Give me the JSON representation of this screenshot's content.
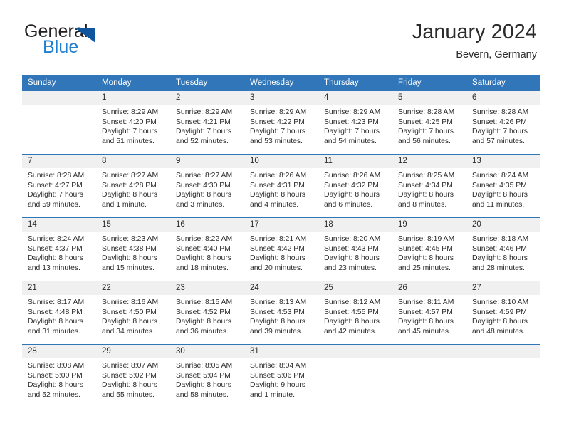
{
  "brand": {
    "name_part1": "General",
    "name_part2": "Blue",
    "triangle_icon": "triangle-icon"
  },
  "header": {
    "title": "January 2024",
    "location": "Bevern, Germany"
  },
  "colors": {
    "header_blue": "#3176b9",
    "row_divider": "#2f76b7",
    "daynum_band": "#f0f0f0",
    "logo_blue": "#1f7fd0",
    "logo_triangle": "#10569e",
    "text": "#2b2b2b"
  },
  "calendar": {
    "weekday_headers": [
      "Sunday",
      "Monday",
      "Tuesday",
      "Wednesday",
      "Thursday",
      "Friday",
      "Saturday"
    ],
    "weeks": [
      [
        {
          "day": "",
          "lines": []
        },
        {
          "day": "1",
          "lines": [
            "Sunrise: 8:29 AM",
            "Sunset: 4:20 PM",
            "Daylight: 7 hours",
            "and 51 minutes."
          ]
        },
        {
          "day": "2",
          "lines": [
            "Sunrise: 8:29 AM",
            "Sunset: 4:21 PM",
            "Daylight: 7 hours",
            "and 52 minutes."
          ]
        },
        {
          "day": "3",
          "lines": [
            "Sunrise: 8:29 AM",
            "Sunset: 4:22 PM",
            "Daylight: 7 hours",
            "and 53 minutes."
          ]
        },
        {
          "day": "4",
          "lines": [
            "Sunrise: 8:29 AM",
            "Sunset: 4:23 PM",
            "Daylight: 7 hours",
            "and 54 minutes."
          ]
        },
        {
          "day": "5",
          "lines": [
            "Sunrise: 8:28 AM",
            "Sunset: 4:25 PM",
            "Daylight: 7 hours",
            "and 56 minutes."
          ]
        },
        {
          "day": "6",
          "lines": [
            "Sunrise: 8:28 AM",
            "Sunset: 4:26 PM",
            "Daylight: 7 hours",
            "and 57 minutes."
          ]
        }
      ],
      [
        {
          "day": "7",
          "lines": [
            "Sunrise: 8:28 AM",
            "Sunset: 4:27 PM",
            "Daylight: 7 hours",
            "and 59 minutes."
          ]
        },
        {
          "day": "8",
          "lines": [
            "Sunrise: 8:27 AM",
            "Sunset: 4:28 PM",
            "Daylight: 8 hours",
            "and 1 minute."
          ]
        },
        {
          "day": "9",
          "lines": [
            "Sunrise: 8:27 AM",
            "Sunset: 4:30 PM",
            "Daylight: 8 hours",
            "and 3 minutes."
          ]
        },
        {
          "day": "10",
          "lines": [
            "Sunrise: 8:26 AM",
            "Sunset: 4:31 PM",
            "Daylight: 8 hours",
            "and 4 minutes."
          ]
        },
        {
          "day": "11",
          "lines": [
            "Sunrise: 8:26 AM",
            "Sunset: 4:32 PM",
            "Daylight: 8 hours",
            "and 6 minutes."
          ]
        },
        {
          "day": "12",
          "lines": [
            "Sunrise: 8:25 AM",
            "Sunset: 4:34 PM",
            "Daylight: 8 hours",
            "and 8 minutes."
          ]
        },
        {
          "day": "13",
          "lines": [
            "Sunrise: 8:24 AM",
            "Sunset: 4:35 PM",
            "Daylight: 8 hours",
            "and 11 minutes."
          ]
        }
      ],
      [
        {
          "day": "14",
          "lines": [
            "Sunrise: 8:24 AM",
            "Sunset: 4:37 PM",
            "Daylight: 8 hours",
            "and 13 minutes."
          ]
        },
        {
          "day": "15",
          "lines": [
            "Sunrise: 8:23 AM",
            "Sunset: 4:38 PM",
            "Daylight: 8 hours",
            "and 15 minutes."
          ]
        },
        {
          "day": "16",
          "lines": [
            "Sunrise: 8:22 AM",
            "Sunset: 4:40 PM",
            "Daylight: 8 hours",
            "and 18 minutes."
          ]
        },
        {
          "day": "17",
          "lines": [
            "Sunrise: 8:21 AM",
            "Sunset: 4:42 PM",
            "Daylight: 8 hours",
            "and 20 minutes."
          ]
        },
        {
          "day": "18",
          "lines": [
            "Sunrise: 8:20 AM",
            "Sunset: 4:43 PM",
            "Daylight: 8 hours",
            "and 23 minutes."
          ]
        },
        {
          "day": "19",
          "lines": [
            "Sunrise: 8:19 AM",
            "Sunset: 4:45 PM",
            "Daylight: 8 hours",
            "and 25 minutes."
          ]
        },
        {
          "day": "20",
          "lines": [
            "Sunrise: 8:18 AM",
            "Sunset: 4:46 PM",
            "Daylight: 8 hours",
            "and 28 minutes."
          ]
        }
      ],
      [
        {
          "day": "21",
          "lines": [
            "Sunrise: 8:17 AM",
            "Sunset: 4:48 PM",
            "Daylight: 8 hours",
            "and 31 minutes."
          ]
        },
        {
          "day": "22",
          "lines": [
            "Sunrise: 8:16 AM",
            "Sunset: 4:50 PM",
            "Daylight: 8 hours",
            "and 34 minutes."
          ]
        },
        {
          "day": "23",
          "lines": [
            "Sunrise: 8:15 AM",
            "Sunset: 4:52 PM",
            "Daylight: 8 hours",
            "and 36 minutes."
          ]
        },
        {
          "day": "24",
          "lines": [
            "Sunrise: 8:13 AM",
            "Sunset: 4:53 PM",
            "Daylight: 8 hours",
            "and 39 minutes."
          ]
        },
        {
          "day": "25",
          "lines": [
            "Sunrise: 8:12 AM",
            "Sunset: 4:55 PM",
            "Daylight: 8 hours",
            "and 42 minutes."
          ]
        },
        {
          "day": "26",
          "lines": [
            "Sunrise: 8:11 AM",
            "Sunset: 4:57 PM",
            "Daylight: 8 hours",
            "and 45 minutes."
          ]
        },
        {
          "day": "27",
          "lines": [
            "Sunrise: 8:10 AM",
            "Sunset: 4:59 PM",
            "Daylight: 8 hours",
            "and 48 minutes."
          ]
        }
      ],
      [
        {
          "day": "28",
          "lines": [
            "Sunrise: 8:08 AM",
            "Sunset: 5:00 PM",
            "Daylight: 8 hours",
            "and 52 minutes."
          ]
        },
        {
          "day": "29",
          "lines": [
            "Sunrise: 8:07 AM",
            "Sunset: 5:02 PM",
            "Daylight: 8 hours",
            "and 55 minutes."
          ]
        },
        {
          "day": "30",
          "lines": [
            "Sunrise: 8:05 AM",
            "Sunset: 5:04 PM",
            "Daylight: 8 hours",
            "and 58 minutes."
          ]
        },
        {
          "day": "31",
          "lines": [
            "Sunrise: 8:04 AM",
            "Sunset: 5:06 PM",
            "Daylight: 9 hours",
            "and 1 minute."
          ]
        },
        {
          "day": "",
          "lines": []
        },
        {
          "day": "",
          "lines": []
        },
        {
          "day": "",
          "lines": []
        }
      ]
    ]
  }
}
